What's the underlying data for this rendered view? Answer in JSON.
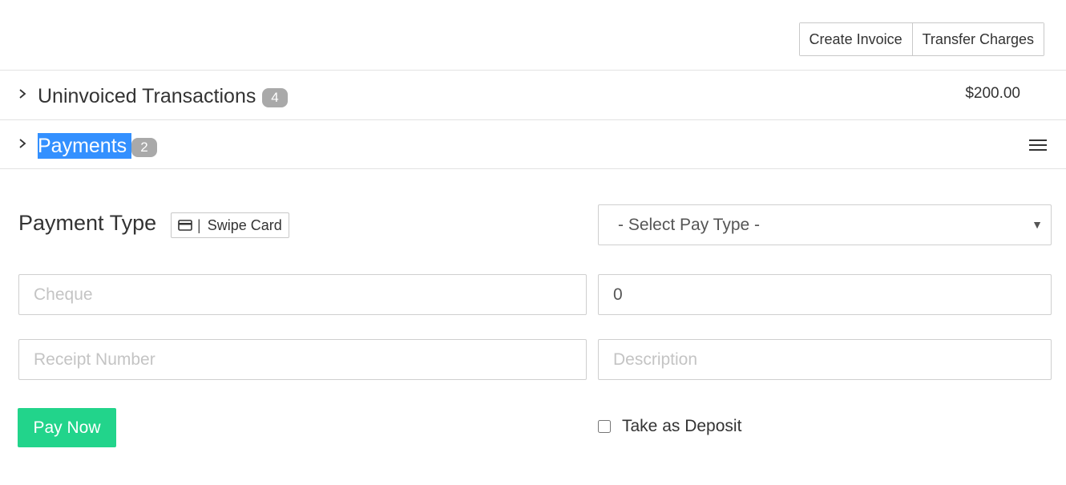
{
  "toolbar": {
    "create_invoice": "Create Invoice",
    "transfer_charges": "Transfer Charges"
  },
  "uninvoiced": {
    "title": "Uninvoiced Transactions",
    "count": "4",
    "amount": "$200.00"
  },
  "payments": {
    "title": "Payments",
    "count": "2"
  },
  "form": {
    "payment_type_label": "Payment Type",
    "swipe_card_label": "Swipe Card",
    "pay_type_selected": "- Select Pay Type -",
    "cheque_placeholder": "Cheque",
    "amount_value": "0",
    "receipt_placeholder": "Receipt Number",
    "description_placeholder": "Description",
    "pay_now_label": "Pay Now",
    "deposit_label": "Take as Deposit",
    "deposit_checked": false
  },
  "icons": {
    "chevron": "chevron-right-icon",
    "menu": "hamburger-menu-icon",
    "card": "credit-card-icon",
    "caret": "caret-down-icon"
  },
  "colors": {
    "accent_green": "#22d48b",
    "selection_blue": "#3390ff",
    "badge_gray": "#a9a9a9"
  }
}
